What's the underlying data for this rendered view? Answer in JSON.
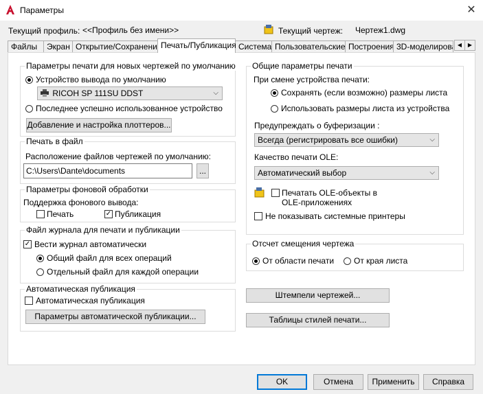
{
  "window": {
    "title": "Параметры"
  },
  "profile": {
    "current_profile_label": "Текущий профиль:",
    "current_profile_value": "<<Профиль без имени>>",
    "current_drawing_label": "Текущий чертеж:",
    "current_drawing_value": "Чертеж1.dwg"
  },
  "tabs": [
    {
      "label": "Файлы"
    },
    {
      "label": "Экран"
    },
    {
      "label": "Открытие/Сохранение"
    },
    {
      "label": "Печать/Публикация"
    },
    {
      "label": "Система"
    },
    {
      "label": "Пользовательские"
    },
    {
      "label": "Построения"
    },
    {
      "label": "3D-моделирова"
    }
  ],
  "default_print": {
    "title": "Параметры печати для новых чертежей по умолчанию",
    "device_default_label": "Устройство вывода по умолчанию",
    "device_value": "RICOH SP 111SU DDST",
    "last_device_label": "Последнее успешно использованное устройство",
    "add_plotters_button": "Добавление и настройка плоттеров..."
  },
  "print_to_file": {
    "title": "Печать в файл",
    "location_label": "Расположение файлов чертежей по умолчанию:",
    "location_value": "C:\\Users\\Dante\\documents",
    "browse_button": "..."
  },
  "background": {
    "title": "Параметры фоновой обработки",
    "support_label": "Поддержка фонового вывода:",
    "print_label": "Печать",
    "publish_label": "Публикация"
  },
  "log": {
    "title": "Файл журнала для печати и публикации",
    "auto_label": "Вести журнал автоматически",
    "shared_label": "Общий файл для всех операций",
    "separate_label": "Отдельный файл для каждой операции"
  },
  "auto_publish": {
    "title": "Автоматическая публикация",
    "check_label": "Автоматическая публикация",
    "settings_button": "Параметры автоматической публикации..."
  },
  "general": {
    "title": "Общие параметры печати",
    "on_change_label": "При смене устройства печати:",
    "keep_size_label": "Сохранять (если возможно) размеры листа",
    "device_size_label": "Использовать размеры листа из устройства",
    "spool_label": "Предупреждать о буферизации :",
    "spool_value": "Всегда (регистрировать все ошибки)",
    "ole_quality_label": "Качество печати OLE:",
    "ole_quality_value": "Автоматический выбор",
    "ole_print_label_1": "Печатать OLE-объекты в",
    "ole_print_label_2": "OLE-приложениях",
    "hide_system_label": "Не показывать системные принтеры"
  },
  "offset": {
    "title": "Отсчет смещения чертежа",
    "printable_label": "От области печати",
    "edge_label": "От края листа"
  },
  "side_buttons": {
    "stamps": "Штемпели чертежей...",
    "style_tables": "Таблицы стилей печати..."
  },
  "footer": {
    "ok": "OK",
    "cancel": "Отмена",
    "apply": "Применить",
    "help": "Справка"
  },
  "colors": {
    "accent": "#0078d7",
    "app_icon": "#c8102e"
  }
}
